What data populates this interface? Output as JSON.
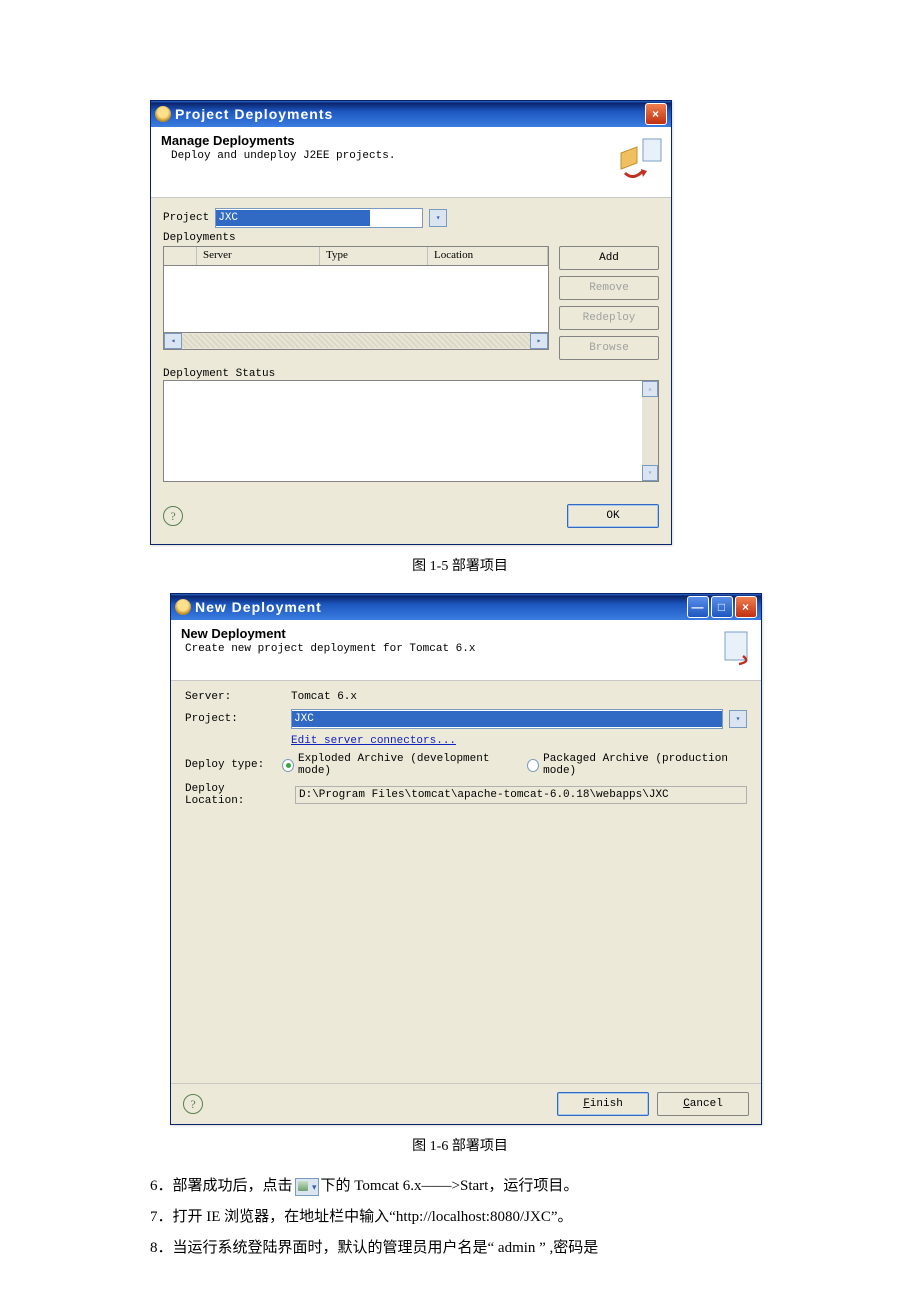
{
  "dialog1": {
    "title": "Project Deployments",
    "banner_title": "Manage Deployments",
    "banner_sub": "Deploy and undeploy J2EE projects.",
    "project_label": "Project",
    "project_value": "JXC",
    "deployments_label": "Deployments",
    "columns": {
      "server": "Server",
      "type": "Type",
      "location": "Location"
    },
    "buttons": {
      "add": "Add",
      "remove": "Remove",
      "redeploy": "Redeploy",
      "browse": "Browse"
    },
    "status_label": "Deployment Status",
    "ok": "OK"
  },
  "caption1": "图 1-5   部署项目",
  "dialog2": {
    "title": "New Deployment",
    "banner_title": "New Deployment",
    "banner_sub": "Create new project deployment for Tomcat  6.x",
    "server_label": "Server:",
    "server_value": "Tomcat  6.x",
    "project_label": "Project:",
    "project_value": "JXC",
    "edit_link": "Edit server connectors...",
    "deploy_type_label": "Deploy type:",
    "radio_exploded": "Exploded Archive (development mode)",
    "radio_packaged": "Packaged Archive (production mode)",
    "deploy_loc_label": "Deploy Location:",
    "deploy_loc_value": "D:\\Program Files\\tomcat\\apache-tomcat-6.0.18\\webapps\\JXC",
    "finish_u": "F",
    "finish_rest": "inish",
    "cancel_u": "C",
    "cancel_rest": "ancel"
  },
  "caption2": "图 1-6   部署项目",
  "doc": {
    "line6a": "6．部署成功后，点击",
    "line6b": "下的 Tomcat 6.x——>Start，运行项目。",
    "line7": "7．打开 IE 浏览器，在地址栏中输入“http://localhost:8080/JXC”。",
    "line8": "8．当运行系统登陆界面时，默认的管理员用户名是“ admin ” ,密码是"
  }
}
